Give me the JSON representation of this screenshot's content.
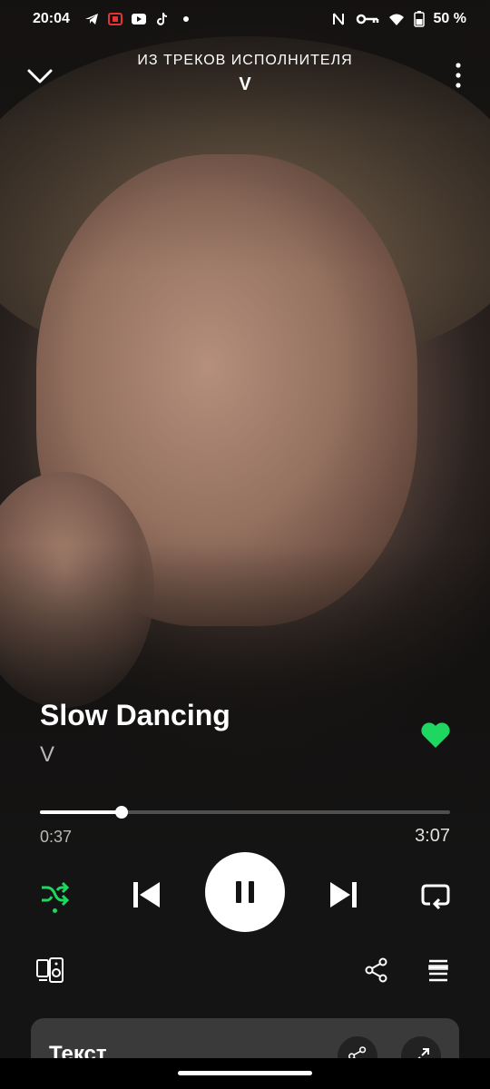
{
  "status_bar": {
    "time": "20:04",
    "battery": "50 %",
    "left_icons": [
      "telegram-icon",
      "app-icon",
      "youtube-icon",
      "tiktok-icon",
      "dot-icon"
    ],
    "right_icons": [
      "nfc-icon",
      "key-icon",
      "wifi-icon",
      "battery-icon"
    ]
  },
  "header": {
    "context_label": "ИЗ ТРЕКОВ ИСПОЛНИТЕЛЯ",
    "context_name": "V"
  },
  "track": {
    "title": "Slow Dancing",
    "artist": "V",
    "liked": true
  },
  "playback": {
    "elapsed": "0:37",
    "total": "3:07",
    "progress_fraction": 0.2,
    "state": "playing",
    "shuffle_enabled": true
  },
  "lyrics_card": {
    "label": "Текст"
  },
  "colors": {
    "accent": "#1ed760",
    "background": "#141414",
    "card": "#3a3a3a"
  }
}
